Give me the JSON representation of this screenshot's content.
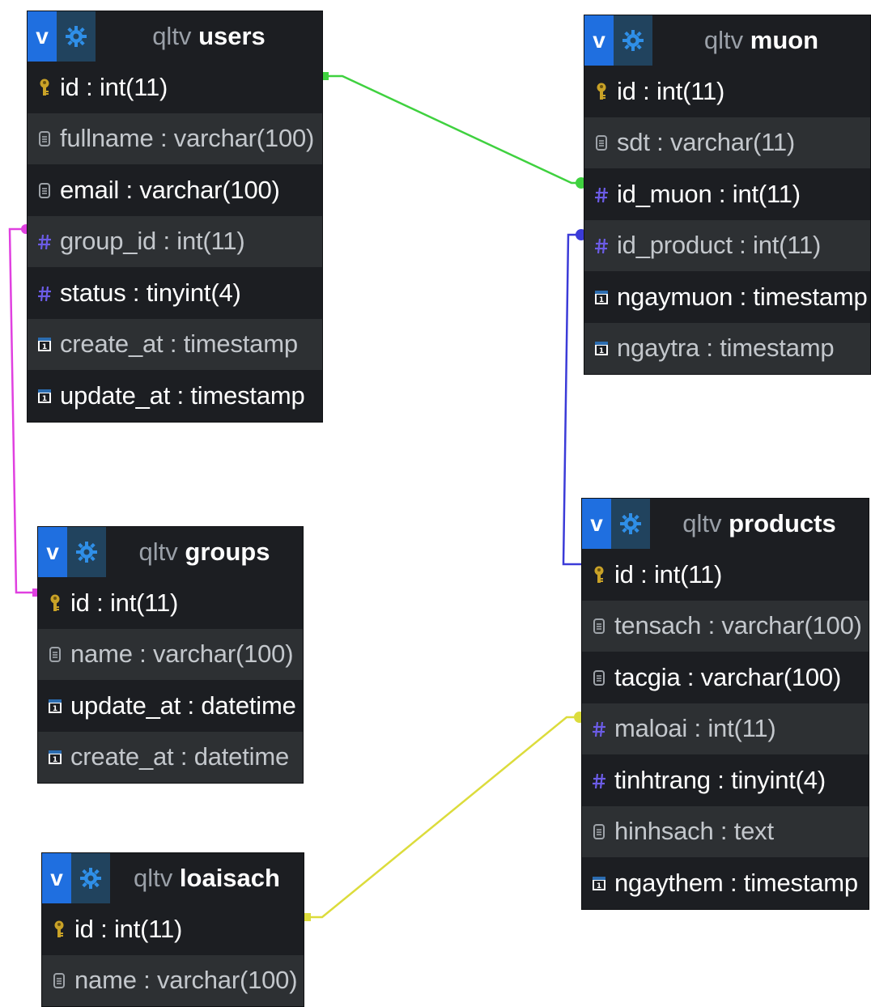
{
  "header_buttons": {
    "view_label": "v",
    "options_icon": "gear-icon"
  },
  "colors": {
    "users_groups_link": "#e040e0",
    "users_muon_link": "#3fd13f",
    "muon_products_link": "#3b3bd8",
    "products_loaisach_link": "#dcdc3c",
    "view_button": "#1f6fe0",
    "options_button": "#21435e"
  },
  "tables": {
    "users": {
      "db": "qltv",
      "name": "users",
      "columns": [
        {
          "text": "id : int(11)",
          "icon": "key-icon"
        },
        {
          "text": "fullname : varchar(100)",
          "icon": "text-field-icon"
        },
        {
          "text": "email : varchar(100)",
          "icon": "text-field-icon"
        },
        {
          "text": "group_id : int(11)",
          "icon": "numeric-field-icon"
        },
        {
          "text": "status : tinyint(4)",
          "icon": "numeric-field-icon"
        },
        {
          "text": "create_at : timestamp",
          "icon": "date-field-icon"
        },
        {
          "text": "update_at : timestamp",
          "icon": "date-field-icon"
        }
      ]
    },
    "muon": {
      "db": "qltv",
      "name": "muon",
      "columns": [
        {
          "text": "id : int(11)",
          "icon": "key-icon"
        },
        {
          "text": "sdt : varchar(11)",
          "icon": "text-field-icon"
        },
        {
          "text": "id_muon : int(11)",
          "icon": "numeric-field-icon"
        },
        {
          "text": "id_product : int(11)",
          "icon": "numeric-field-icon"
        },
        {
          "text": "ngaymuon : timestamp",
          "icon": "date-field-icon"
        },
        {
          "text": "ngaytra : timestamp",
          "icon": "date-field-icon"
        }
      ]
    },
    "groups": {
      "db": "qltv",
      "name": "groups",
      "columns": [
        {
          "text": "id : int(11)",
          "icon": "key-icon"
        },
        {
          "text": "name : varchar(100)",
          "icon": "text-field-icon"
        },
        {
          "text": "update_at : datetime",
          "icon": "date-field-icon"
        },
        {
          "text": "create_at : datetime",
          "icon": "date-field-icon"
        }
      ]
    },
    "products": {
      "db": "qltv",
      "name": "products",
      "columns": [
        {
          "text": "id : int(11)",
          "icon": "key-icon"
        },
        {
          "text": "tensach : varchar(100)",
          "icon": "text-field-icon"
        },
        {
          "text": "tacgia : varchar(100)",
          "icon": "text-field-icon"
        },
        {
          "text": "maloai : int(11)",
          "icon": "numeric-field-icon"
        },
        {
          "text": "tinhtrang : tinyint(4)",
          "icon": "numeric-field-icon"
        },
        {
          "text": "hinhsach : text",
          "icon": "text-field-icon"
        },
        {
          "text": "ngaythem : timestamp",
          "icon": "date-field-icon"
        }
      ]
    },
    "loaisach": {
      "db": "qltv",
      "name": "loaisach",
      "columns": [
        {
          "text": "id : int(11)",
          "icon": "key-icon"
        },
        {
          "text": "name : varchar(100)",
          "icon": "text-field-icon"
        }
      ]
    }
  }
}
